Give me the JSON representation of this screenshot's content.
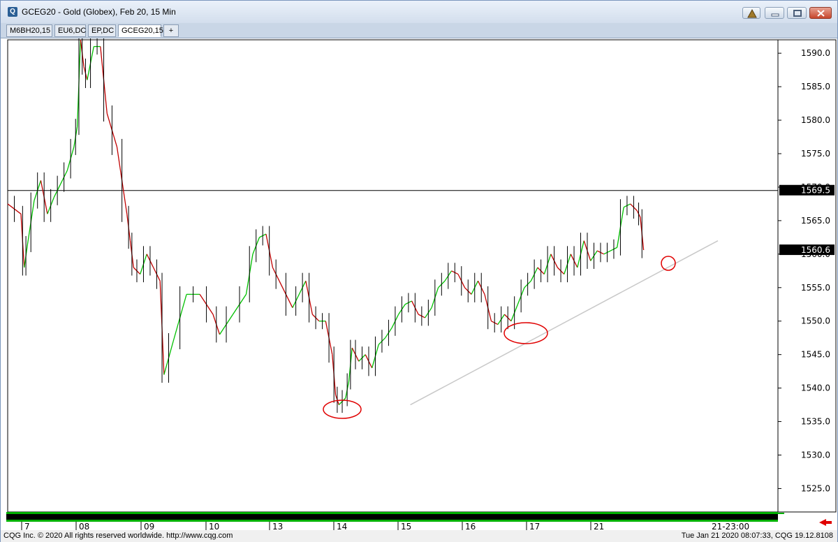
{
  "window": {
    "title": "GCEG20 - Gold (Globex), Feb 20, 15 Min",
    "app_icon": "Q"
  },
  "tabs": [
    {
      "label": "M6BH20,15"
    },
    {
      "label": "EU6,DC"
    },
    {
      "label": "EP,DC"
    },
    {
      "label": "GCEG20,15",
      "active": true
    },
    {
      "label": "+"
    }
  ],
  "chart_data": {
    "type": "line",
    "symbol": "GCEG20",
    "interval": "15 Min",
    "y_ticks": [
      "1590.0",
      "1585.0",
      "1580.0",
      "1575.0",
      "1570.0",
      "1565.0",
      "1560.0",
      "1555.0",
      "1550.0",
      "1545.0",
      "1540.0",
      "1535.0",
      "1530.0",
      "1525.0"
    ],
    "x_ticks": [
      "7",
      "08",
      "09",
      "10",
      "13",
      "14",
      "15",
      "16",
      "17",
      "21"
    ],
    "x_time_label": "21-23:00",
    "ylim": [
      1521.5,
      1592.0
    ],
    "horizontal_line": {
      "value": 1569.5,
      "label": "1569.5"
    },
    "last_price": {
      "value": 1560.6,
      "label": "1560.6"
    },
    "trendline": {
      "from": {
        "x": 0.53,
        "y": 1537.5
      },
      "to": {
        "x": 1.0,
        "y": 1562.0
      }
    },
    "annotations": [
      {
        "type": "circle",
        "x_day": "14",
        "y": 1537.0
      },
      {
        "type": "circle",
        "x_day": "17",
        "y": 1548.0
      },
      {
        "type": "circle",
        "x_day": "21",
        "y": 1558.5
      }
    ],
    "series": [
      {
        "values": [
          [
            0.0,
            1567.5
          ],
          [
            0.02,
            1566.0
          ],
          [
            0.025,
            1558.0
          ],
          [
            0.03,
            1561.5
          ],
          [
            0.04,
            1568.0
          ],
          [
            0.05,
            1571.0
          ],
          [
            0.06,
            1566.0
          ],
          [
            0.07,
            1568.5
          ],
          [
            0.08,
            1570.5
          ],
          [
            0.09,
            1572.5
          ],
          [
            0.1,
            1576.0
          ],
          [
            0.105,
            1579.0
          ],
          [
            0.11,
            1592.0
          ],
          [
            0.115,
            1588.0
          ],
          [
            0.12,
            1586.0
          ],
          [
            0.13,
            1591.0
          ],
          [
            0.14,
            1591.0
          ],
          [
            0.15,
            1581.0
          ],
          [
            0.165,
            1576.0
          ],
          [
            0.18,
            1566.0
          ],
          [
            0.185,
            1562.0
          ],
          [
            0.19,
            1558.0
          ],
          [
            0.2,
            1557.0
          ],
          [
            0.21,
            1560.0
          ],
          [
            0.22,
            1558.0
          ],
          [
            0.23,
            1556.0
          ],
          [
            0.236,
            1542.0
          ],
          [
            0.25,
            1547.0
          ],
          [
            0.27,
            1554.0
          ],
          [
            0.29,
            1554.0
          ],
          [
            0.31,
            1551.0
          ],
          [
            0.32,
            1548.0
          ],
          [
            0.34,
            1551.0
          ],
          [
            0.36,
            1554.0
          ],
          [
            0.37,
            1560.0
          ],
          [
            0.38,
            1562.5
          ],
          [
            0.39,
            1563.0
          ],
          [
            0.4,
            1558.0
          ],
          [
            0.41,
            1556.0
          ],
          [
            0.43,
            1552.0
          ],
          [
            0.44,
            1554.0
          ],
          [
            0.45,
            1556.0
          ],
          [
            0.46,
            1551.0
          ],
          [
            0.47,
            1550.0
          ],
          [
            0.48,
            1550.0
          ],
          [
            0.49,
            1545.0
          ],
          [
            0.495,
            1539.0
          ],
          [
            0.5,
            1537.5
          ],
          [
            0.51,
            1538.5
          ],
          [
            0.515,
            1541.0
          ],
          [
            0.52,
            1546.0
          ],
          [
            0.53,
            1544.0
          ],
          [
            0.54,
            1545.0
          ],
          [
            0.55,
            1543.0
          ],
          [
            0.56,
            1546.5
          ],
          [
            0.57,
            1547.5
          ],
          [
            0.58,
            1549.0
          ],
          [
            0.59,
            1551.0
          ],
          [
            0.6,
            1552.5
          ],
          [
            0.61,
            1553.0
          ],
          [
            0.62,
            1551.0
          ],
          [
            0.63,
            1550.5
          ],
          [
            0.64,
            1552.0
          ],
          [
            0.65,
            1555.0
          ],
          [
            0.66,
            1556.0
          ],
          [
            0.67,
            1557.5
          ],
          [
            0.68,
            1557.0
          ],
          [
            0.69,
            1555.0
          ],
          [
            0.7,
            1554.0
          ],
          [
            0.71,
            1556.0
          ],
          [
            0.72,
            1554.0
          ],
          [
            0.73,
            1550.0
          ],
          [
            0.74,
            1549.5
          ],
          [
            0.75,
            1551.0
          ],
          [
            0.76,
            1550.0
          ],
          [
            0.77,
            1552.5
          ],
          [
            0.78,
            1555.0
          ],
          [
            0.79,
            1556.0
          ],
          [
            0.8,
            1558.0
          ],
          [
            0.81,
            1557.0
          ],
          [
            0.82,
            1560.0
          ],
          [
            0.83,
            1558.0
          ],
          [
            0.84,
            1557.0
          ],
          [
            0.85,
            1560.0
          ],
          [
            0.86,
            1558.0
          ],
          [
            0.87,
            1562.0
          ],
          [
            0.88,
            1559.0
          ],
          [
            0.89,
            1560.5
          ],
          [
            0.9,
            1560.0
          ],
          [
            0.91,
            1560.5
          ],
          [
            0.92,
            1561.0
          ],
          [
            0.93,
            1567.0
          ],
          [
            0.94,
            1567.5
          ],
          [
            0.95,
            1566.5
          ],
          [
            0.955,
            1565.5
          ],
          [
            0.96,
            1560.6
          ]
        ]
      }
    ],
    "x_ticks_pos": [
      0.02,
      0.11,
      0.195,
      0.285,
      0.375,
      0.47,
      0.56,
      0.65,
      0.74,
      0.83,
      0.995
    ]
  },
  "status": {
    "copyright": "CQG Inc. © 2020 All rights reserved worldwide. http://www.cqg.com",
    "datetime": "Tue Jan 21 2020 08:07:33, CQG 19.12.8108"
  },
  "colors": {
    "up": "#00c000",
    "down": "#c00000",
    "trendline": "#c8c8c8",
    "annotation": "#e00000"
  }
}
